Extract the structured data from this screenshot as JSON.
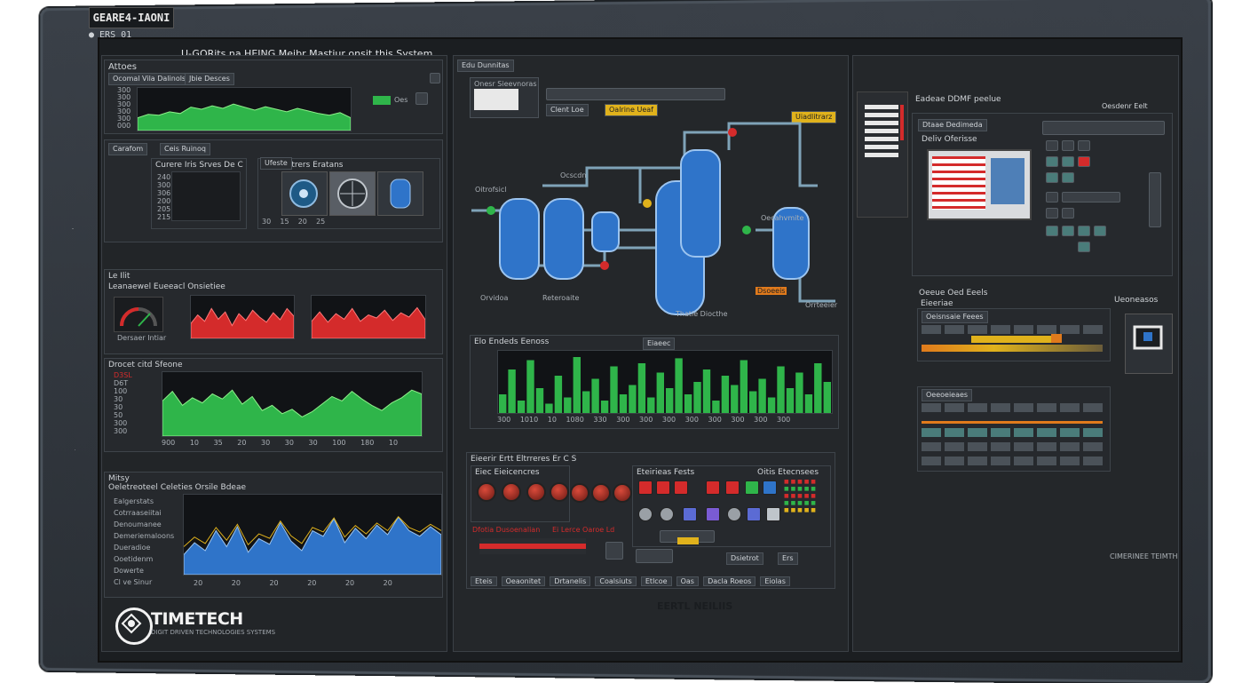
{
  "window": {
    "brand_tag": "GEARE4-IAONI",
    "top_code": "● ERS 01",
    "app_title": "U-GORits na HEING Meibr Mastiur onsit this System",
    "footer_center": "EERTL NEILIIS",
    "footer_right": "CIMERINEE TEIMTH"
  },
  "left": {
    "panel1": {
      "title": "Attoes",
      "tabs": [
        "Ocomal Vila Dalinols",
        "Jbie Desces"
      ],
      "y_ticks": [
        "300",
        "300",
        "300",
        "300",
        "300",
        "000"
      ],
      "status": "Oes"
    },
    "panel2": {
      "tabs": [
        "Carafom",
        "Ceis Ruinoq"
      ],
      "sub1_title": "Curere Iris Srves De C",
      "sub2_title": "Eefs Retrers Eratans",
      "sub2_tab": "Ufeste",
      "y_ticks": [
        "240",
        "300",
        "306",
        "200",
        "205",
        "215",
        "340"
      ],
      "x_ticks": [
        "30",
        "15",
        "20",
        "25"
      ]
    },
    "panel3": {
      "title": "Le Ilit",
      "subtitle": "Leanaewel Eueeacl Onsietiee",
      "gauge_label": "Dersaer Intiar"
    },
    "panel4": {
      "title": "Drocet citd Sfeone",
      "y_ticks": [
        "D3SL",
        "D6T",
        "100",
        "30",
        "30",
        "50",
        "300",
        "300"
      ],
      "x_ticks": [
        "900",
        "10",
        "35",
        "20",
        "30",
        "30",
        "30",
        "100",
        "180",
        "10"
      ]
    },
    "panel5": {
      "title": "Mitsy",
      "subtitle": "Oeletreoteel Celeties Orsile Bdeae",
      "y_ticks": [
        "Ealgerstats",
        "Cotrraaseiitai",
        "Denoumanee",
        "Demeriemaloons",
        "Dueradioe",
        "Ooetidenm",
        "Dowerte",
        "Cl ve Sinur"
      ],
      "x_ticks": [
        "20",
        "20",
        "20",
        "20",
        "20",
        "20"
      ]
    }
  },
  "center": {
    "header_tab": "Edu Dunnitas",
    "mini_title": "Onesr Sieevnoras",
    "toolbar_labels": [
      "Clent Loe",
      "Oalrine Ueaf"
    ],
    "toolbar_right": "Uiadlitrarz",
    "tank_labels": [
      "Oitrofsicl",
      "Ocscdn",
      "Orvidoa",
      "Reteroaite",
      "Thatie Diocthe",
      "Dsoeeis",
      "Oecahvmite",
      "Orrteeier"
    ],
    "bar_panel": {
      "title": "Elo Endeds Eenoss",
      "mid_tab": "Eiaeec",
      "x_ticks": [
        "300",
        "1010",
        "10",
        "1080",
        "330",
        "300",
        "300",
        "300",
        "300",
        "300",
        "300",
        "300",
        "300"
      ]
    },
    "control": {
      "title": "Eieerir Ertt Eltrreres Er C S",
      "sub_left": "Eiec Eieicencres",
      "sub_right": "Eteirieas Fests",
      "sub_right2": "Oitis Etecnsees",
      "alarm1": "Dfotia Dusoenalian",
      "alarm2": "Ei Lerce Oaroe Ld",
      "bottom_tabs": [
        "Eteis",
        "Oeaonitet",
        "Drtanelis",
        "Coalsiuts",
        "Etlcoe",
        "Oas",
        "Dacla Roeos",
        "Eiolas"
      ],
      "right_bottom": [
        "Dsietrot",
        "Ers"
      ]
    }
  },
  "right": {
    "panel_title": "Eadeae DDMF peelue",
    "panel_right": "Oesdenr Eelt",
    "sub_title": "Dtaae Dedimeda",
    "sub_label": "Deliv Oferisse",
    "lower_title": "Oeeue Oed Eeels",
    "lower_sub": "Eieeriae",
    "lower_tab": "Oeisnsaie Feees",
    "lower_tab2": "Oeeoeieaes",
    "side_label": "Ueoneasos"
  },
  "branding": {
    "logo_text": "TIMETECH",
    "logo_sub": "DIGIT DRIVEN TECHNOLOGIES SYSTEMS"
  },
  "colors": {
    "green": "#2fb54a",
    "red": "#d42b2b",
    "blue": "#2f74c9",
    "yellow": "#e0b21c",
    "orange": "#e07a1c",
    "panel": "#26292d",
    "screen": "#1b1e21"
  },
  "chart_data": [
    {
      "type": "area",
      "title": "",
      "series": [
        {
          "values": [
            30,
            38,
            36,
            44,
            40,
            55,
            50,
            58,
            52,
            62,
            55,
            48,
            56,
            50,
            44,
            52,
            46,
            40,
            36,
            42,
            30
          ]
        }
      ],
      "ylim": [
        0,
        100
      ]
    },
    {
      "type": "area",
      "title": "",
      "series": [
        {
          "values": [
            35,
            55,
            40,
            70,
            45,
            62,
            30,
            58,
            42,
            66,
            50,
            38,
            60,
            44,
            70,
            52
          ]
        }
      ],
      "ylim": [
        0,
        100
      ]
    },
    {
      "type": "area",
      "title": "",
      "series": [
        {
          "values": [
            40,
            62,
            38,
            58,
            45,
            70,
            40,
            55,
            48,
            66,
            42,
            60,
            50,
            72,
            44
          ]
        }
      ],
      "ylim": [
        0,
        100
      ]
    },
    {
      "type": "area",
      "title": "",
      "series": [
        {
          "values": [
            55,
            70,
            48,
            60,
            52,
            66,
            58,
            72,
            50,
            62,
            40,
            48,
            35,
            42,
            30,
            38,
            50,
            62,
            55,
            70,
            58,
            48,
            40,
            52,
            60,
            72,
            66
          ]
        }
      ],
      "ylim": [
        0,
        100
      ]
    },
    {
      "type": "area",
      "title": "",
      "series": [
        {
          "values": [
            25,
            40,
            30,
            55,
            35,
            60,
            28,
            45,
            38,
            65,
            42,
            30,
            55,
            48,
            70,
            40,
            58,
            45,
            62,
            50,
            72,
            55,
            48,
            60,
            50
          ]
        }
      ],
      "ylim": [
        0,
        100
      ]
    },
    {
      "type": "bar",
      "title": "",
      "series": [
        {
          "values": [
            30,
            70,
            20,
            85,
            40,
            15,
            60,
            25,
            90,
            35,
            55,
            20,
            75,
            30,
            45,
            80,
            25,
            65,
            40,
            88,
            30,
            50,
            70,
            20,
            60,
            45,
            85,
            35,
            55,
            25,
            75,
            40,
            65,
            30,
            80,
            50
          ]
        }
      ],
      "ylim": [
        0,
        100
      ]
    }
  ]
}
